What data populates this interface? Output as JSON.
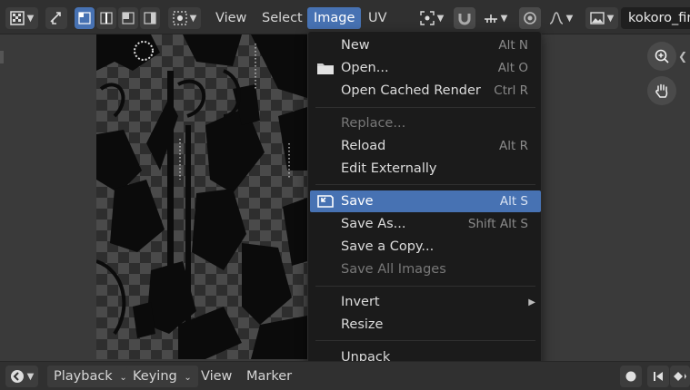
{
  "header": {
    "menus": [
      {
        "label": "View"
      },
      {
        "label": "Select"
      },
      {
        "label": "Image"
      },
      {
        "label": "UV"
      }
    ],
    "image_name": "kokoro_fin"
  },
  "image_menu": {
    "groups": [
      [
        {
          "label": "New",
          "shortcut": "Alt N",
          "icon": "none"
        },
        {
          "label": "Open...",
          "shortcut": "Alt O",
          "icon": "folder-icon"
        },
        {
          "label": "Open Cached Render",
          "shortcut": "Ctrl R",
          "icon": "none"
        }
      ],
      [
        {
          "label": "Replace...",
          "shortcut": "",
          "disabled": true
        },
        {
          "label": "Reload",
          "shortcut": "Alt R"
        },
        {
          "label": "Edit Externally",
          "shortcut": ""
        }
      ],
      [
        {
          "label": "Save",
          "shortcut": "Alt S",
          "highlight": true,
          "icon": "save-icon"
        },
        {
          "label": "Save As...",
          "shortcut": "Shift Alt S"
        },
        {
          "label": "Save a Copy...",
          "shortcut": ""
        },
        {
          "label": "Save All Images",
          "shortcut": "",
          "disabled": true
        }
      ],
      [
        {
          "label": "Invert",
          "shortcut": "",
          "submenu": true
        },
        {
          "label": "Resize",
          "shortcut": ""
        }
      ],
      [
        {
          "label": "Unpack",
          "shortcut": ""
        }
      ]
    ]
  },
  "footer": {
    "playback": "Playback",
    "keying": "Keying",
    "view": "View",
    "marker": "Marker"
  },
  "colors": {
    "accent": "#4772b3",
    "menu_bg": "#1b1b1b",
    "header_bg": "#303030"
  }
}
